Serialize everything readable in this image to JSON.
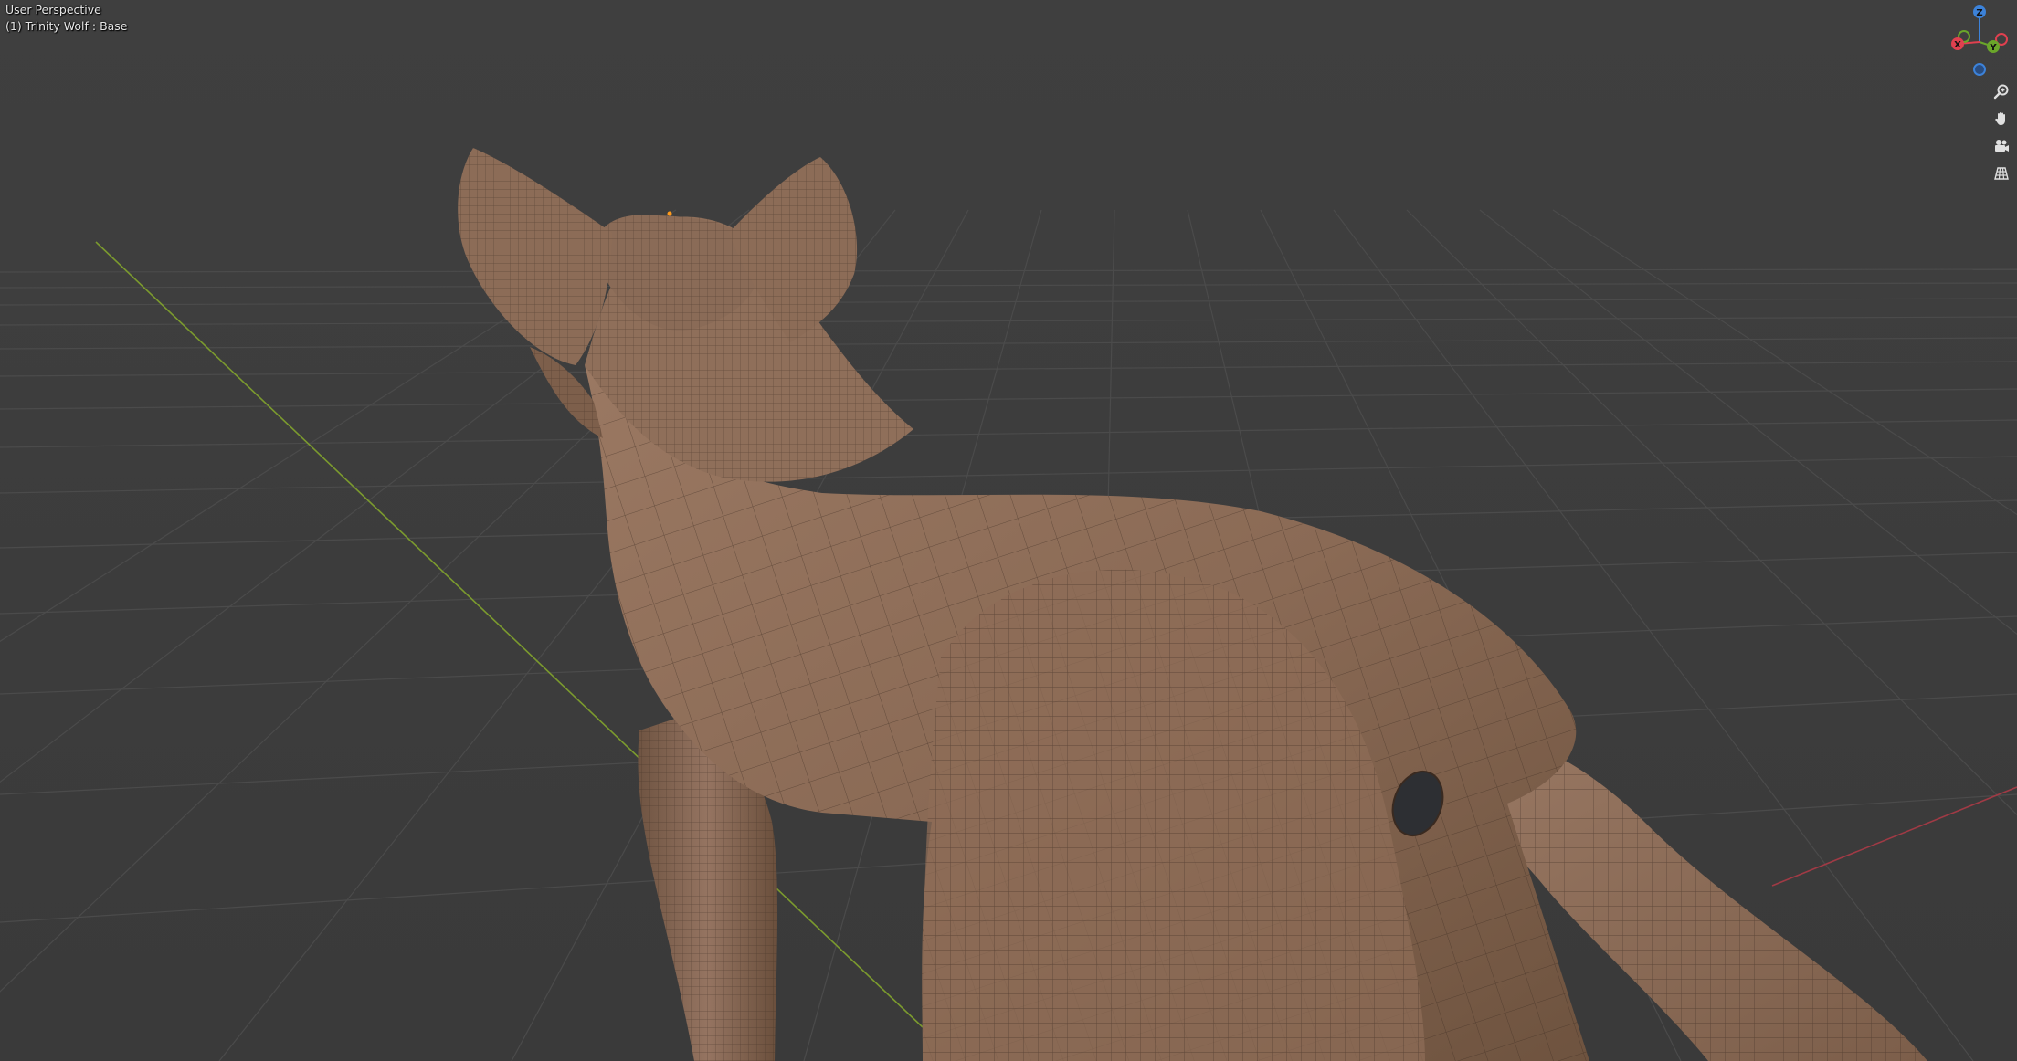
{
  "viewport": {
    "view_name": "User Perspective",
    "object_name": "(1) Trinity Wolf : Base"
  },
  "gizmo": {
    "z_label": "Z",
    "y_label": "Y",
    "x_label": "X",
    "colors": {
      "x": "#e0404f",
      "y": "#6aa62a",
      "z": "#3c82d9"
    }
  },
  "nav_buttons": [
    {
      "icon": "zoom-icon"
    },
    {
      "icon": "hand-pan-icon"
    },
    {
      "icon": "camera-icon"
    },
    {
      "icon": "ortho-grid-icon"
    }
  ],
  "colors": {
    "background": "#3d3d3d",
    "grid_line": "#4b4b4b",
    "x_axis": "#a03a45",
    "y_axis": "#7b9a2e",
    "mesh_fill": "#8a6a55",
    "mesh_wire": "#3a2a20",
    "origin_dot": "#ff9a1a"
  }
}
